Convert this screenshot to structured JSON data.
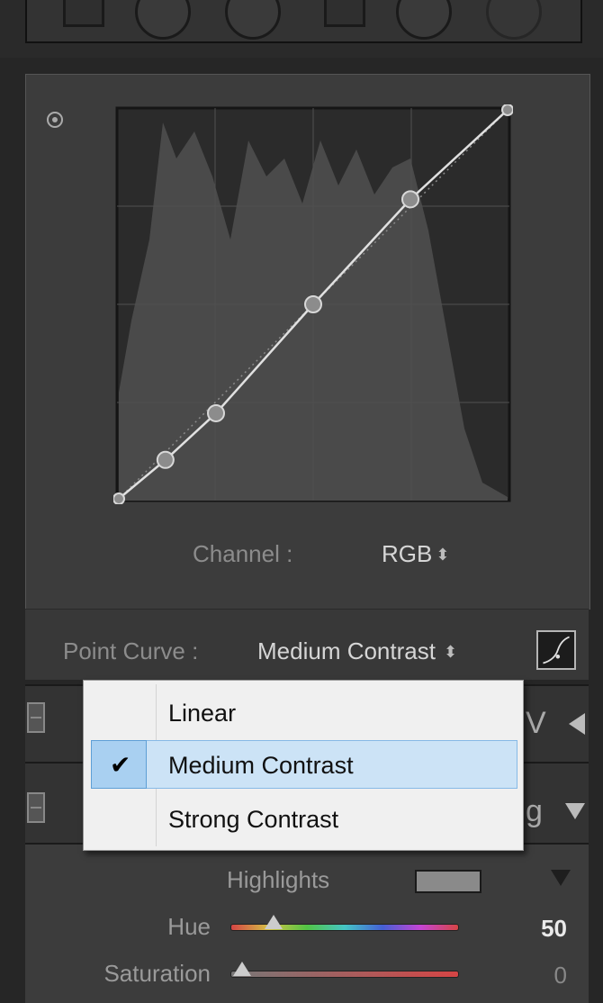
{
  "curve": {
    "channel_label": "Channel :",
    "channel_value": "RGB",
    "points": [
      [
        0,
        0
      ],
      [
        0.12,
        0.1
      ],
      [
        0.25,
        0.22
      ],
      [
        0.5,
        0.5
      ],
      [
        0.75,
        0.77
      ],
      [
        1,
        1
      ]
    ]
  },
  "point_curve": {
    "label": "Point Curve :",
    "value": "Medium Contrast"
  },
  "menu": {
    "items": [
      {
        "label": "Linear",
        "selected": false
      },
      {
        "label": "Medium Contrast",
        "selected": true
      },
      {
        "label": "Strong Contrast",
        "selected": false
      }
    ]
  },
  "split_toning": {
    "highlights_label": "Highlights",
    "highlight_color": "#8a8a8a",
    "hue_label": "Hue",
    "hue_value": "50",
    "hue_fraction": 0.19,
    "saturation_label": "Saturation",
    "saturation_value": "0",
    "saturation_fraction": 0.05
  },
  "behind_text": {
    "panel_a_letter": "V",
    "panel_b_letter": "g"
  },
  "colors": {
    "accent_selected": "#cce3f6",
    "curve_line": "#e0e0e0"
  }
}
